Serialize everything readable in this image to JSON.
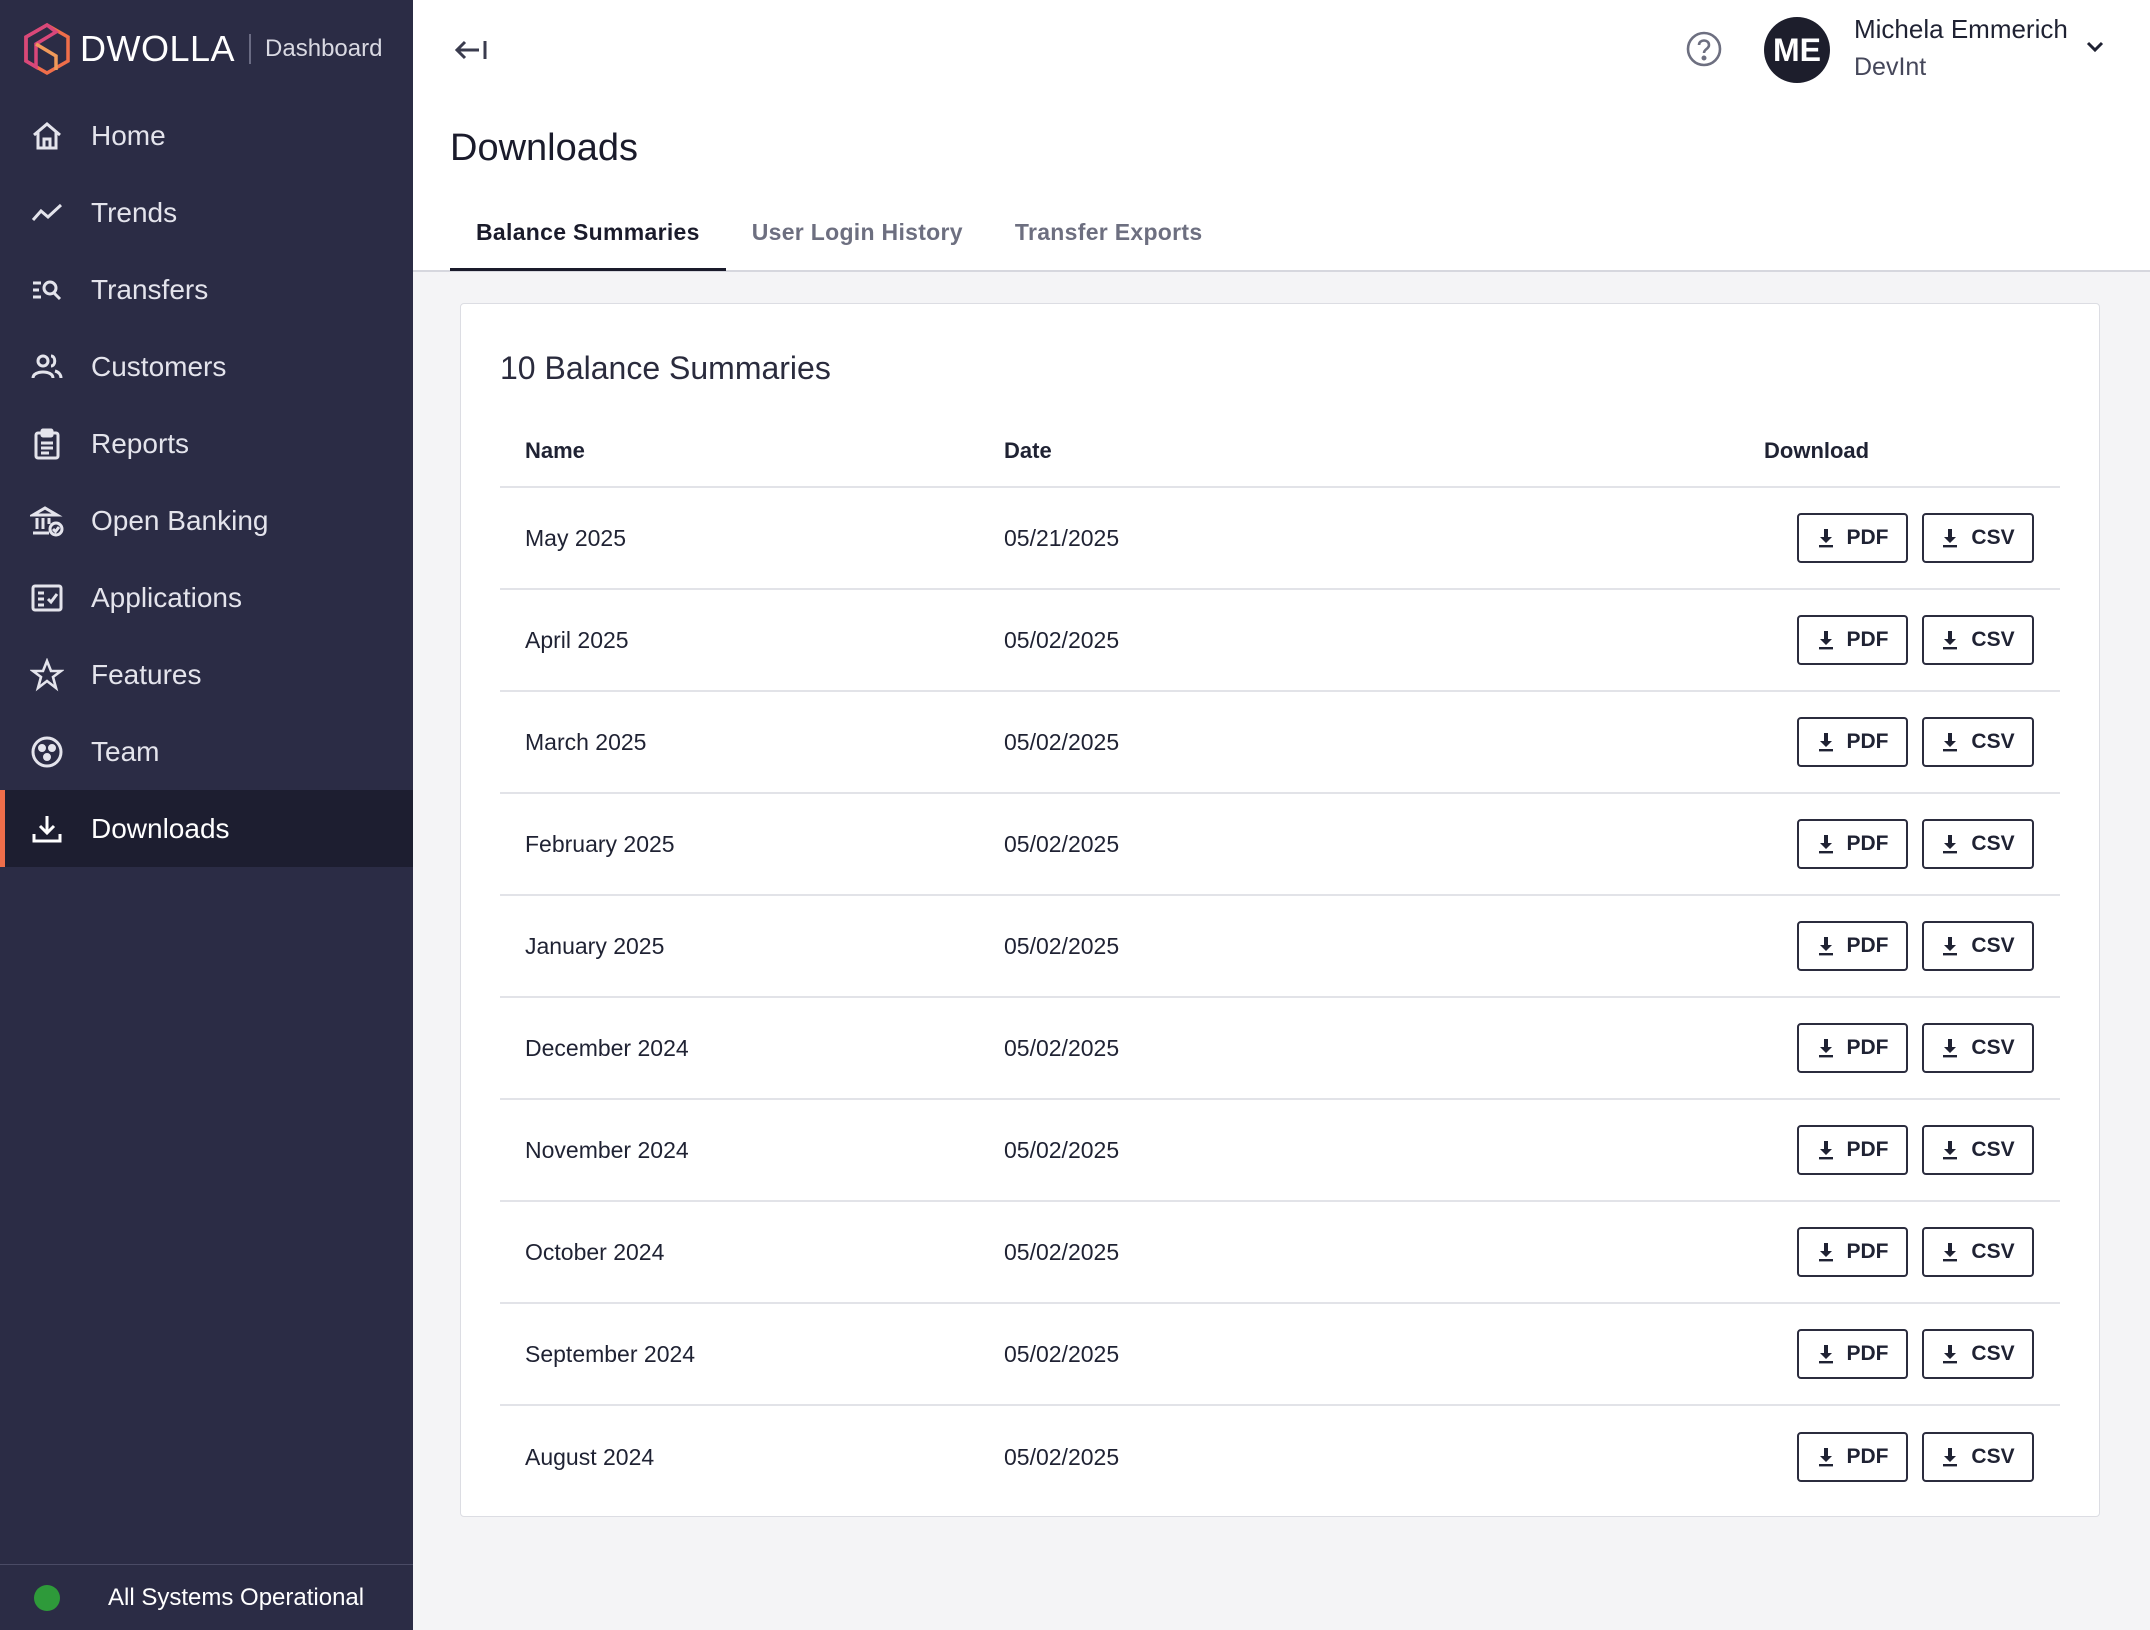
{
  "brand": {
    "name": "DWOLLA",
    "product": "Dashboard",
    "accent": "#ef6e4a"
  },
  "sidebar": {
    "items": [
      {
        "label": "Home",
        "icon": "home-icon"
      },
      {
        "label": "Trends",
        "icon": "trend-line-icon"
      },
      {
        "label": "Transfers",
        "icon": "list-search-icon"
      },
      {
        "label": "Customers",
        "icon": "people-icon"
      },
      {
        "label": "Reports",
        "icon": "clipboard-icon"
      },
      {
        "label": "Open Banking",
        "icon": "bank-check-icon"
      },
      {
        "label": "Applications",
        "icon": "checklist-icon"
      },
      {
        "label": "Features",
        "icon": "star-icon"
      },
      {
        "label": "Team",
        "icon": "team-circle-icon"
      },
      {
        "label": "Downloads",
        "icon": "download-icon",
        "active": true
      }
    ],
    "status": {
      "text": "All Systems Operational",
      "color": "#2e9a3a"
    }
  },
  "header": {
    "user": {
      "initials": "ME",
      "name": "Michela Emmerich",
      "org": "DevInt"
    }
  },
  "page": {
    "title": "Downloads",
    "tabs": [
      {
        "label": "Balance Summaries",
        "active": true
      },
      {
        "label": "User Login History"
      },
      {
        "label": "Transfer Exports"
      }
    ]
  },
  "table": {
    "title": "10 Balance Summaries",
    "columns": {
      "name": "Name",
      "date": "Date",
      "download": "Download"
    },
    "pdf_label": "PDF",
    "csv_label": "CSV",
    "rows": [
      {
        "name": "May 2025",
        "date": "05/21/2025"
      },
      {
        "name": "April 2025",
        "date": "05/02/2025"
      },
      {
        "name": "March 2025",
        "date": "05/02/2025"
      },
      {
        "name": "February 2025",
        "date": "05/02/2025"
      },
      {
        "name": "January 2025",
        "date": "05/02/2025"
      },
      {
        "name": "December 2024",
        "date": "05/02/2025"
      },
      {
        "name": "November 2024",
        "date": "05/02/2025"
      },
      {
        "name": "October 2024",
        "date": "05/02/2025"
      },
      {
        "name": "September 2024",
        "date": "05/02/2025"
      },
      {
        "name": "August 2024",
        "date": "05/02/2025"
      }
    ]
  }
}
